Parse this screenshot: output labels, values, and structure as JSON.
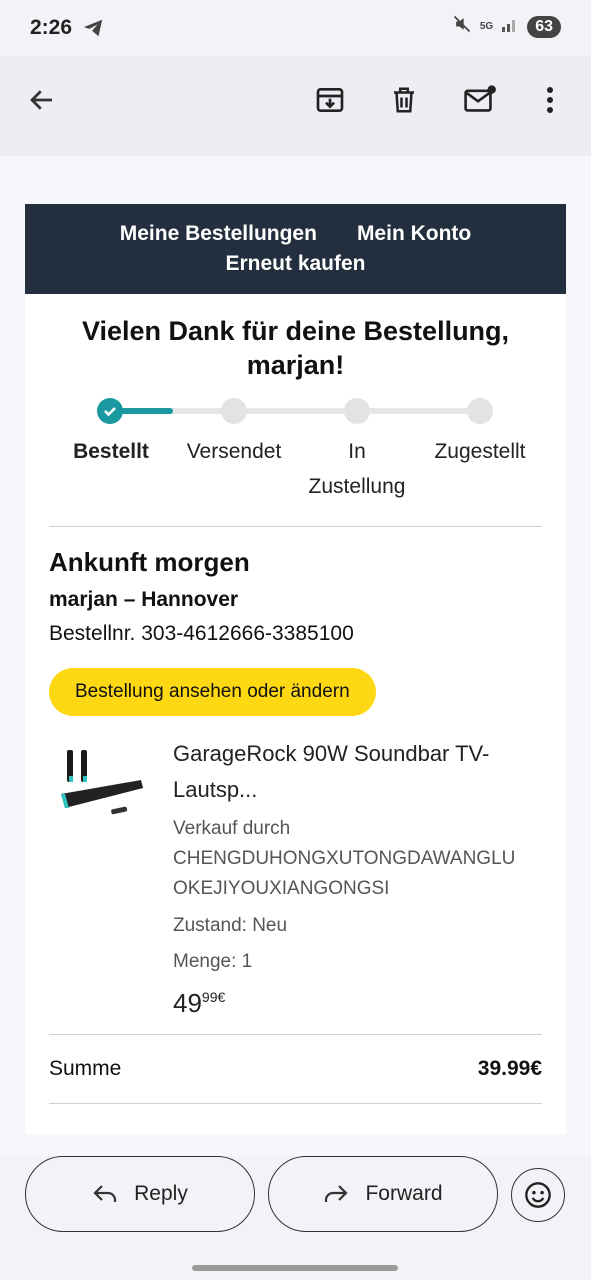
{
  "status": {
    "time": "2:26",
    "network": "5G",
    "battery": "63"
  },
  "toolbar": {
    "icons": [
      "back-arrow-icon",
      "archive-icon",
      "delete-icon",
      "mark-unread-icon",
      "more-vert-icon"
    ]
  },
  "email": {
    "nav": {
      "orders": "Meine Bestellungen",
      "account": "Mein Konto",
      "buy_again": "Erneut kaufen"
    },
    "thanks_line1": "Vielen Dank für deine Bestellung,",
    "thanks_line2": "marjan!",
    "steps": [
      {
        "label": "Bestellt",
        "state": "done"
      },
      {
        "label": "Versendet",
        "state": "pending"
      },
      {
        "label": "In Zustellung",
        "state": "pending"
      },
      {
        "label": "Zugestellt",
        "state": "pending"
      }
    ],
    "step_labels": {
      "ordered": "Bestellt",
      "shipped": "Versendet",
      "in_delivery_1": "In",
      "in_delivery_2": "Zustellung",
      "delivered": "Zugestellt"
    },
    "arrival": {
      "title": "Ankunft morgen",
      "name": "marjan – Hannover",
      "order_number": "Bestellnr. 303-4612666-3385100",
      "button": "Bestellung ansehen oder ändern"
    },
    "product": {
      "title_line1": "GarageRock 90W Soundbar TV-",
      "title_line2": "Lautsp...",
      "seller_label": "Verkauf durch",
      "seller_line1": "CHENGDUHONGXUTONGDAWANGLU",
      "seller_line2": "OKEJIYOUXIANGONGSI",
      "condition": "Zustand: Neu",
      "quantity": "Menge: 1",
      "price_main": "49",
      "price_sup": "99€"
    },
    "summary": {
      "label": "Summe",
      "value": "39.99€"
    }
  },
  "actions": {
    "reply": "Reply",
    "forward": "Forward"
  },
  "colors": {
    "nav_bg": "#232f3e",
    "accent_teal": "#1a9aa0",
    "button_yellow": "#ffd814"
  }
}
